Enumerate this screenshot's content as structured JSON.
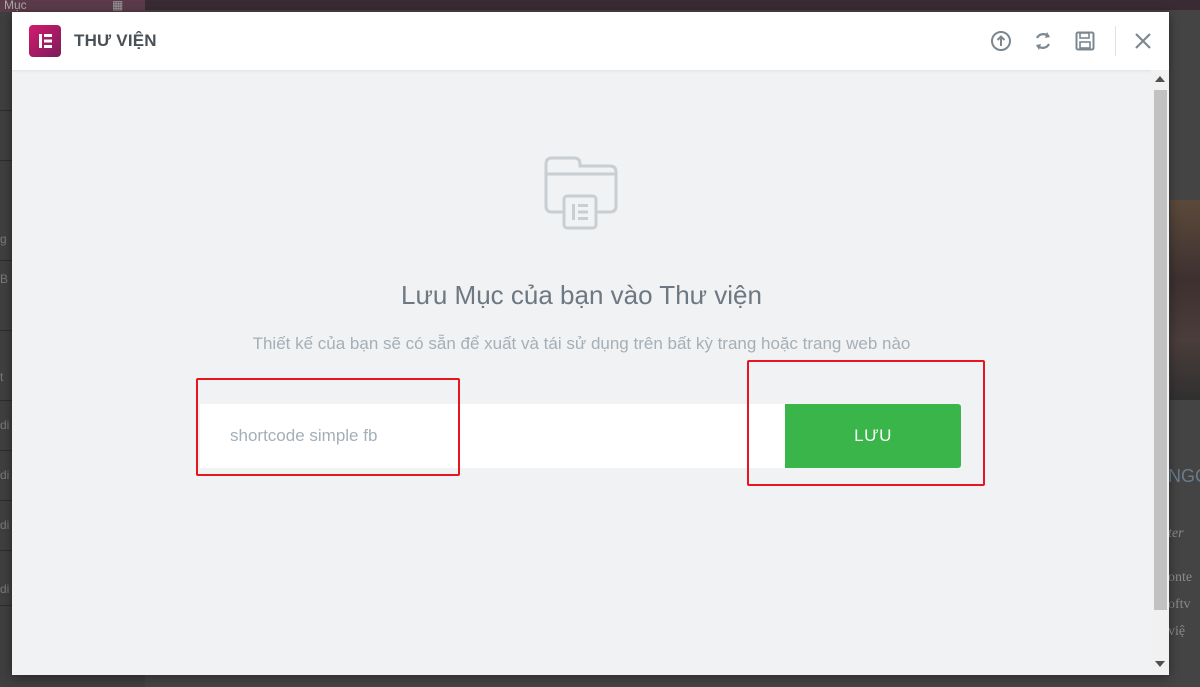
{
  "background": {
    "left_fragment": "Mục",
    "left_items": [
      "g",
      "B",
      "t",
      "di",
      "di",
      "di",
      "di"
    ],
    "right_fragments": [
      "NGC",
      "ter",
      "onte",
      "oftv",
      "việ"
    ]
  },
  "modal": {
    "title": "THƯ VIỆN",
    "toolbar": {
      "icons": [
        "upload-icon",
        "sync-icon",
        "save-icon",
        "close-icon"
      ]
    },
    "content": {
      "heading": "Lưu Mục của bạn vào Thư viện",
      "subheading": "Thiết kế của bạn sẽ có sẵn để xuất và tái sử dụng trên bất kỳ trang hoặc trang web nào",
      "name_input": {
        "value": "shortcode simple fb",
        "placeholder": ""
      },
      "save_label": "LƯU"
    }
  },
  "colors": {
    "accent_green": "#39b54a",
    "annotation_red": "#e5161d",
    "brand_magenta": "#d4196c"
  }
}
